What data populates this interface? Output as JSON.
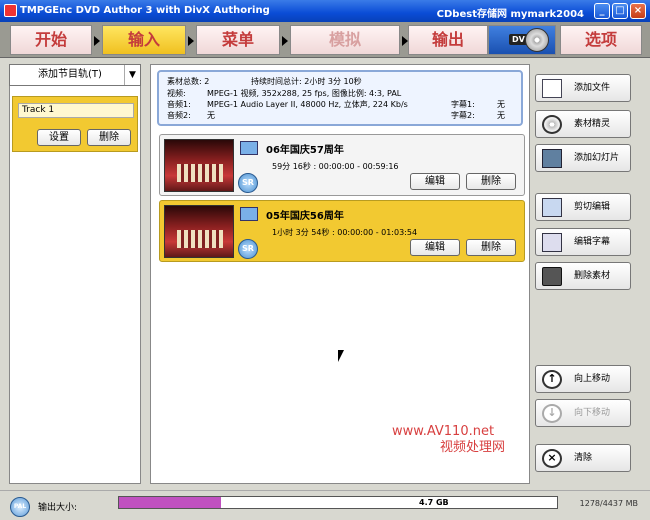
{
  "window": {
    "title": "TMPGEnc DVD Author 3 with DivX Authoring",
    "right_title": "CDbest存储网 mymark2004"
  },
  "nav": {
    "tabs": [
      "开始",
      "输入",
      "菜单",
      "模拟",
      "输出",
      "选项"
    ],
    "active_tab": "输入",
    "dvd_label": "DVD"
  },
  "left": {
    "dropdown_label": "添加节目轨(T)",
    "track_name": "Track 1",
    "settings_label": "设置",
    "delete_label": "删除"
  },
  "info": {
    "clip_count_label": "素材总数: 2",
    "duration_label": "持续时间总计: 2小时 3分 10秒",
    "video_key": "视频:",
    "video_value": "MPEG-1 视频, 352x288, 25 fps, 图像比例: 4:3, PAL",
    "audio1_key": "音频1:",
    "audio1_value": "MPEG-1 Audio Layer II, 48000 Hz, 立体声, 224 Kb/s",
    "audio2_key": "音频2:",
    "audio2_value": "无",
    "sub1_key": "字幕1:",
    "sub1_value": "无",
    "sub2_key": "字幕2:",
    "sub2_value": "无"
  },
  "clips": [
    {
      "title": "06年国庆57周年",
      "duration": "59分 16秒 : 00:00:00 - 00:59:16",
      "edit_label": "编辑",
      "delete_label": "删除",
      "badge": "SR"
    },
    {
      "title": "05年国庆56周年",
      "duration": "1小时 3分 54秒 : 00:00:00 - 01:03:54",
      "edit_label": "编辑",
      "delete_label": "删除",
      "badge": "SR"
    }
  ],
  "actions": {
    "add_file": "添加文件",
    "clip_wizard": "素材精灵",
    "add_slideshow": "添加幻灯片",
    "cut_edit": "剪切编辑",
    "edit_subtitle": "编辑字幕",
    "delete_clip": "删除素材",
    "move_up": "向上移动",
    "move_down": "向下移动",
    "clear": "清除"
  },
  "watermark": {
    "line1": "www.AV110.net",
    "line2": "视频处理网"
  },
  "status": {
    "pal_label": "PAL",
    "output_size_label": "输出大小:",
    "capacity_label": "4.7 GB",
    "progress_fraction": 0.233,
    "size_text": "1278/4437 MB"
  },
  "colors": {
    "accent_yellow": "#f2c931",
    "tab_text_red": "#c43c3c",
    "progress_fill": "#c050c0"
  }
}
